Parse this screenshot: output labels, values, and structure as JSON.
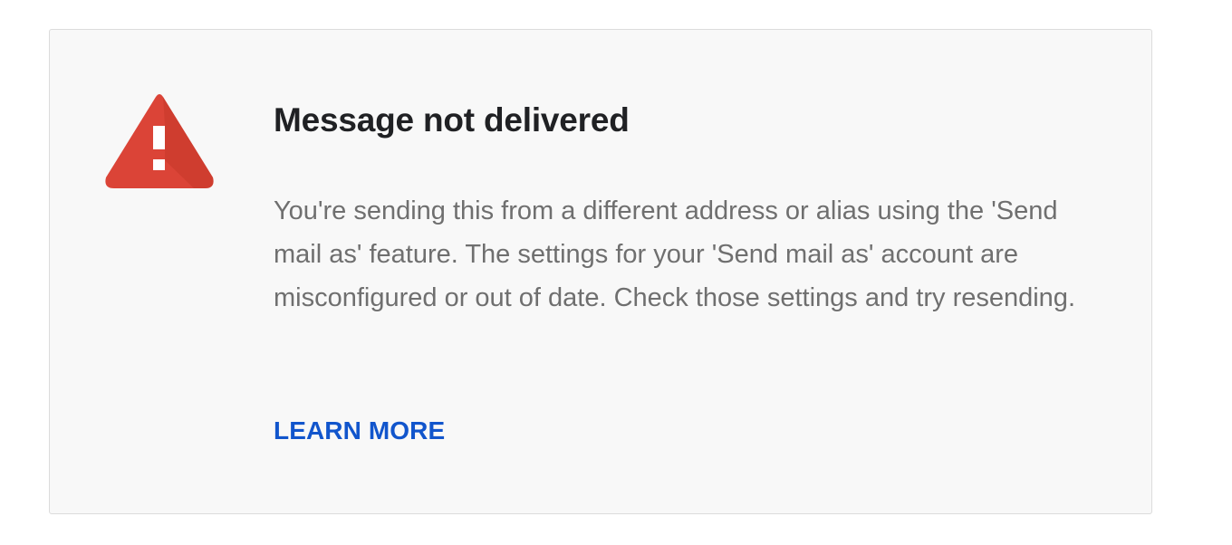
{
  "dialog": {
    "title": "Message not delivered",
    "message": "You're sending this from a different address or alias using the 'Send mail as' feature. The settings for your 'Send mail as' account are misconfigured or out of date. Check those settings and try resending.",
    "learn_more_label": "LEARN MORE"
  },
  "icons": {
    "status": "warning-icon"
  },
  "colors": {
    "warning_red": "#db4437",
    "warning_shadow": "#c53929",
    "title": "#202124",
    "message": "#6f6f6f",
    "link": "#1155cc",
    "card_background": "#f8f8f8",
    "card_border": "#dcdcdc"
  }
}
